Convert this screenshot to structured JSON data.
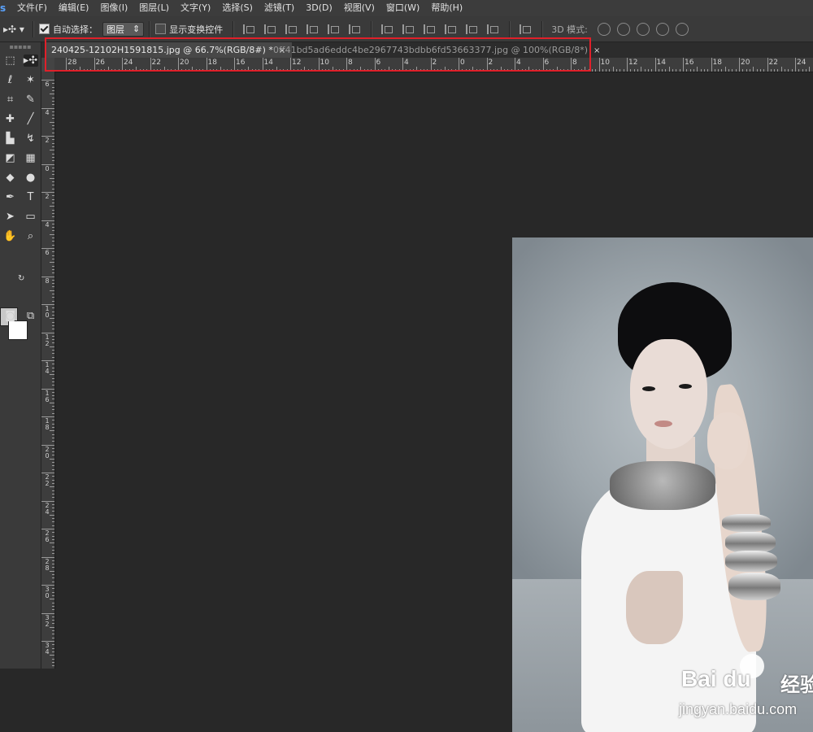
{
  "menu": {
    "logo": "s",
    "items": [
      "文件(F)",
      "编辑(E)",
      "图像(I)",
      "图层(L)",
      "文字(Y)",
      "选择(S)",
      "滤镜(T)",
      "3D(D)",
      "视图(V)",
      "窗口(W)",
      "帮助(H)"
    ]
  },
  "options": {
    "auto_select_label": "自动选择：",
    "auto_select_checked": true,
    "layer_select_value": "图层",
    "show_transform_label": "显示变换控件",
    "show_transform_checked": false,
    "mode3d_label": "3D 模式:"
  },
  "tabs": [
    {
      "label": "240425-12102H1591815.jpg @ 66.7%(RGB/8#) *",
      "close": "×",
      "active": true
    },
    {
      "label": "0ff41bd5ad6eddc4be2967743bdbb6fd53663377.jpg @ 100%(RGB/8*)",
      "close": "×",
      "active": false
    }
  ],
  "ruler": {
    "h_labels": [
      "28",
      "26",
      "24",
      "22",
      "20",
      "18",
      "16",
      "14",
      "12",
      "10",
      "8",
      "6",
      "4",
      "2",
      "0",
      "2",
      "4",
      "6",
      "8",
      "10",
      "12",
      "14",
      "16",
      "18",
      "20",
      "22",
      "24"
    ],
    "v_labels": [
      "6",
      "4",
      "2",
      "0",
      "2",
      "4",
      "6",
      "8",
      "10",
      "12",
      "14",
      "16",
      "18",
      "20",
      "22",
      "24",
      "26",
      "28",
      "30",
      "32",
      "34"
    ]
  },
  "watermark": {
    "brand": "Bai du",
    "cn": "经验",
    "url": "jingyan.baidu.com"
  }
}
